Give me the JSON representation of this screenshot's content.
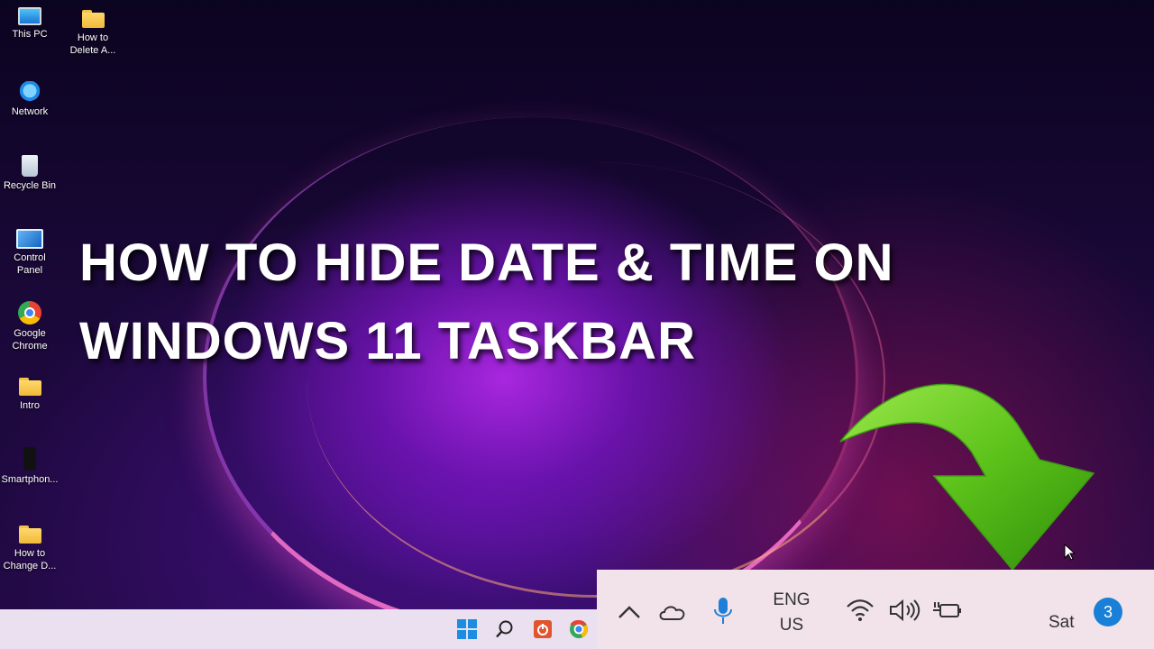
{
  "desktop": {
    "icons": [
      {
        "label": "This PC",
        "icon": "this-pc-icon"
      },
      {
        "label": "How to\nDelete A...",
        "icon": "folder-icon"
      },
      {
        "label": "Network",
        "icon": "network-icon"
      },
      {
        "label": "Recycle Bin",
        "icon": "recycle-bin-icon"
      },
      {
        "label": "Control\nPanel",
        "icon": "control-panel-icon"
      },
      {
        "label": "Google\nChrome",
        "icon": "chrome-icon"
      },
      {
        "label": "Intro",
        "icon": "folder-icon"
      },
      {
        "label": "Smartphon...",
        "icon": "smartphone-icon"
      },
      {
        "label": "How to\nChange D...",
        "icon": "folder-icon"
      }
    ]
  },
  "overlay": {
    "title_line1": "HOW TO HIDE DATE & TIME ON",
    "title_line2": "WINDOWS 11 TASKBAR"
  },
  "taskbar": {
    "pinned": [
      "windows-start-icon",
      "search-icon",
      "app-icon",
      "chrome-icon"
    ],
    "tray": {
      "icons": [
        "chevron-up-icon",
        "cloud-icon",
        "microphone-icon",
        "wifi-icon",
        "volume-icon",
        "battery-charging-icon"
      ],
      "lang_line1": "ENG",
      "lang_line2": "US",
      "day": "Sat",
      "notification_count": "3"
    }
  },
  "colors": {
    "accent": "#1a7fd6",
    "arrow": "#5cc21a",
    "title": "#ffffff"
  }
}
